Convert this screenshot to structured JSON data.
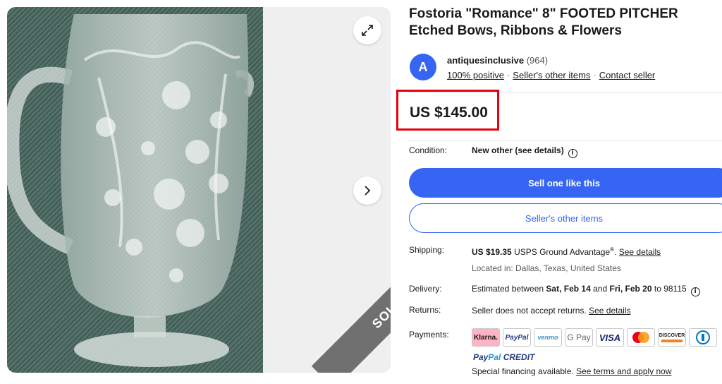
{
  "listing": {
    "title": "Fostoria \"Romance\" 8\" FOOTED PITCHER Etched Bows, Ribbons & Flowers",
    "sold_badge": "SOLD"
  },
  "seller": {
    "avatar_letter": "A",
    "name": "antiquesinclusive",
    "feedback_count": "(964)",
    "positive": "100% positive",
    "other_items_link": "Seller's other items",
    "contact_link": "Contact seller"
  },
  "price": "US $145.00",
  "condition": {
    "label": "Condition:",
    "value": "New other (see details)"
  },
  "buttons": {
    "primary": "Sell one like this",
    "secondary": "Seller's other items"
  },
  "shipping": {
    "label": "Shipping:",
    "cost": "US $19.35",
    "service": "USPS Ground Advantage",
    "trademark": "®",
    "details_link": "See details",
    "location": "Located in: Dallas, Texas, United States"
  },
  "delivery": {
    "label": "Delivery:",
    "prefix": "Estimated between",
    "date_start": "Sat, Feb 14",
    "and_text": "and",
    "date_end": "Fri, Feb 20",
    "to_text": "to 98115"
  },
  "returns": {
    "label": "Returns:",
    "text": "Seller does not accept returns.",
    "details_link": "See details"
  },
  "payments": {
    "label": "Payments:",
    "methods": [
      "Klarna.",
      "PayPal",
      "venmo",
      "G Pay",
      "VISA",
      "mastercard-icon",
      "DISCOVER",
      "diners-club-icon"
    ],
    "paypal_credit_1": "Pay",
    "paypal_credit_2": "Pal",
    "paypal_credit_3": "CREDIT",
    "financing_text": "Special financing available.",
    "financing_link": "See terms and apply now"
  },
  "colors": {
    "accent": "#3665f3",
    "price_highlight": "#e3000f",
    "sold_ribbon": "#707070"
  }
}
